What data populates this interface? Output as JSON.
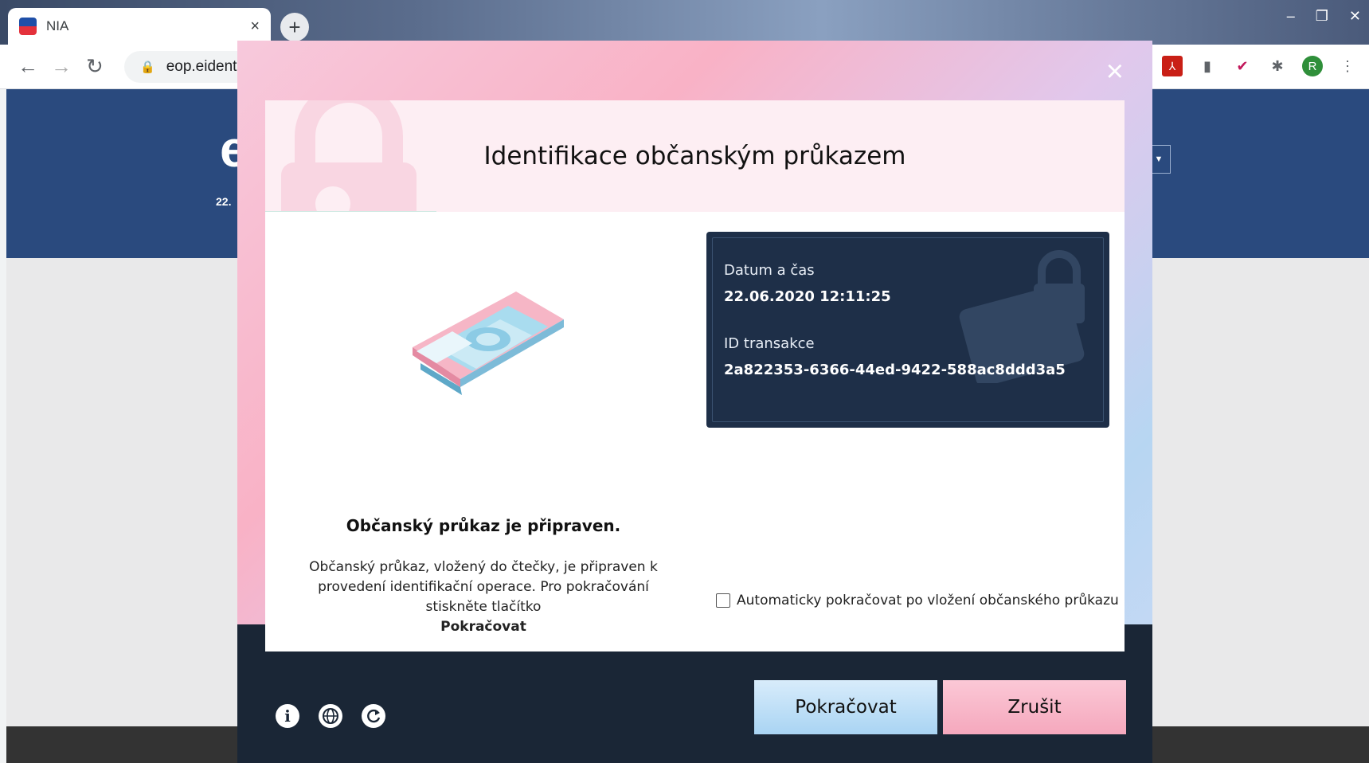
{
  "browser": {
    "tab_title": "NIA",
    "tab_close": "×",
    "new_tab": "+",
    "url": "eop.eidentit",
    "avatar_letter": "R",
    "win_minimize": "–",
    "win_restore": "❐",
    "win_close": "✕"
  },
  "page": {
    "logo": "e",
    "date": "22."
  },
  "dialog": {
    "close": "×",
    "title": "Identifikace občanským průkazem",
    "status_title": "Občanský průkaz je připraven.",
    "status_desc": "Občanský průkaz, vložený do čtečky, je připraven k provedení identifikační operace. Pro pokračování stiskněte tlačítko",
    "status_desc_bold": "Pokračovat",
    "info": {
      "datetime_label": "Datum a čas",
      "datetime_value": "22.06.2020 12:11:25",
      "transaction_label": "ID transakce",
      "transaction_value": "2a822353-6366-44ed-9422-588ac8ddd3a5"
    },
    "auto_continue_label": "Automaticky pokračovat po vložení občanského průkazu",
    "auto_continue_checked": false,
    "continue_button": "Pokračovat",
    "cancel_button": "Zrušit",
    "footer_icons": [
      "info-icon",
      "globe-icon",
      "refresh-icon"
    ],
    "colors": {
      "dark_footer": "#1a2636",
      "info_card": "#1e2f48",
      "continue_bg": "#a9d4f3",
      "cancel_bg": "#f5a8bd"
    }
  }
}
